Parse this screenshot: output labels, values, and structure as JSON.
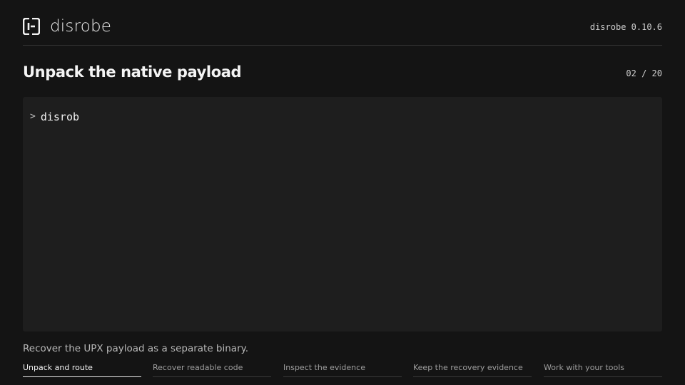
{
  "header": {
    "brand_name": "disrobe",
    "version": "disrobe 0.10.6"
  },
  "slide": {
    "title": "Unpack the native payload",
    "counter": "02 / 20"
  },
  "terminal": {
    "prompt": ">",
    "command": "disrob"
  },
  "caption": "Recover the UPX payload as a separate binary.",
  "tabs": [
    {
      "label": "Unpack and route",
      "active": true
    },
    {
      "label": "Recover readable code",
      "active": false
    },
    {
      "label": "Inspect the evidence",
      "active": false
    },
    {
      "label": "Keep the recovery evidence",
      "active": false
    },
    {
      "label": "Work with your tools",
      "active": false
    }
  ],
  "colors": {
    "background": "#141414",
    "terminal_background": "#1e1e1e",
    "text_primary": "#f2f2f2",
    "text_secondary": "#9e9e9e"
  },
  "icons": {
    "logo": "disrobe-logo-icon"
  }
}
